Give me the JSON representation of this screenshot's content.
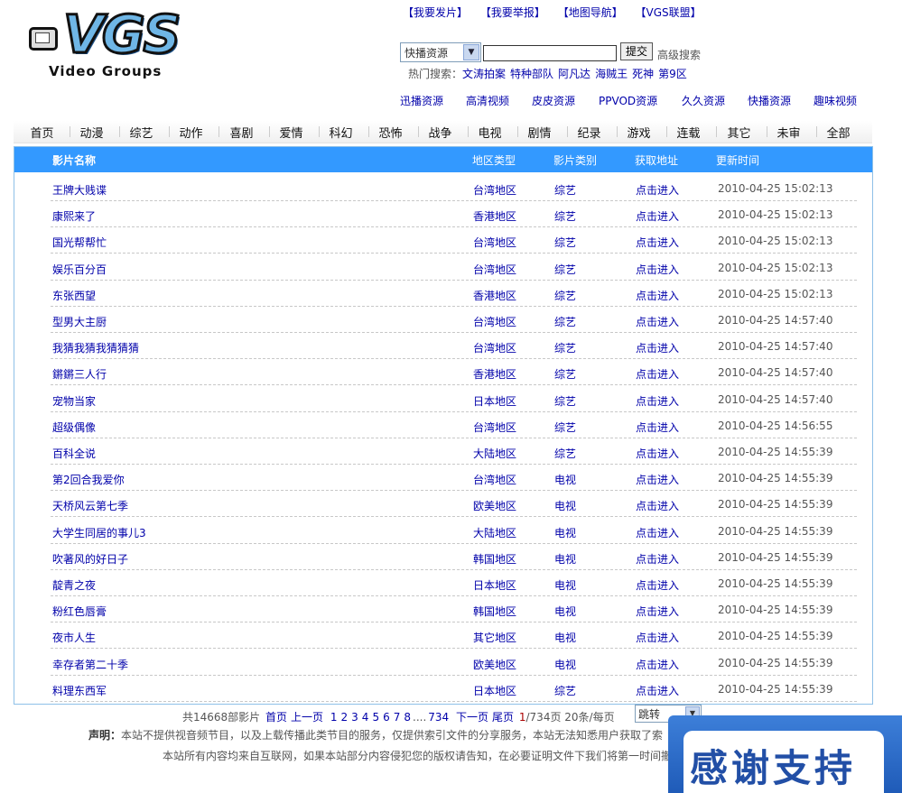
{
  "site": {
    "logo_text": "VGS",
    "logo_sub": "Video Groups"
  },
  "top_links": [
    "【我要发片】",
    "【我要举报】",
    "【地图导航】",
    "【VGS联盟】"
  ],
  "search": {
    "select_value": "快播资源",
    "input_value": "",
    "submit_label": "提交",
    "advanced_label": "高级搜索",
    "hot_label": "热门搜索：",
    "hot_terms": [
      "文涛拍案",
      "特种部队",
      "阿凡达",
      "海贼王",
      "死神",
      "第9区"
    ]
  },
  "resources": [
    "迅播资源",
    "高清视频",
    "皮皮资源",
    "PPVOD资源",
    "久久资源",
    "快播资源",
    "趣味视频"
  ],
  "nav": [
    "首页",
    "动漫",
    "综艺",
    "动作",
    "喜剧",
    "爱情",
    "科幻",
    "恐怖",
    "战争",
    "电视",
    "剧情",
    "纪录",
    "游戏",
    "连载",
    "其它",
    "未审",
    "全部"
  ],
  "list": {
    "headers": {
      "name": "影片名称",
      "region": "地区类型",
      "category": "影片类别",
      "link": "获取地址",
      "updated": "更新时间"
    },
    "rows": [
      {
        "name": "王牌大贱谍",
        "region": "台湾地区",
        "category": "综艺",
        "link": "点击进入",
        "updated": "2010-04-25 15:02:13"
      },
      {
        "name": "康熙来了",
        "region": "香港地区",
        "category": "综艺",
        "link": "点击进入",
        "updated": "2010-04-25 15:02:13"
      },
      {
        "name": "国光帮帮忙",
        "region": "台湾地区",
        "category": "综艺",
        "link": "点击进入",
        "updated": "2010-04-25 15:02:13"
      },
      {
        "name": "娱乐百分百",
        "region": "台湾地区",
        "category": "综艺",
        "link": "点击进入",
        "updated": "2010-04-25 15:02:13"
      },
      {
        "name": "东张西望",
        "region": "香港地区",
        "category": "综艺",
        "link": "点击进入",
        "updated": "2010-04-25 15:02:13"
      },
      {
        "name": "型男大主厨",
        "region": "台湾地区",
        "category": "综艺",
        "link": "点击进入",
        "updated": "2010-04-25 14:57:40"
      },
      {
        "name": "我猜我猜我猜猜猜",
        "region": "台湾地区",
        "category": "综艺",
        "link": "点击进入",
        "updated": "2010-04-25 14:57:40"
      },
      {
        "name": "鏘鏘三人行",
        "region": "香港地区",
        "category": "综艺",
        "link": "点击进入",
        "updated": "2010-04-25 14:57:40"
      },
      {
        "name": "宠物当家",
        "region": "日本地区",
        "category": "综艺",
        "link": "点击进入",
        "updated": "2010-04-25 14:57:40"
      },
      {
        "name": "超级偶像",
        "region": "台湾地区",
        "category": "综艺",
        "link": "点击进入",
        "updated": "2010-04-25 14:56:55"
      },
      {
        "name": "百科全说",
        "region": "大陆地区",
        "category": "综艺",
        "link": "点击进入",
        "updated": "2010-04-25 14:55:39"
      },
      {
        "name": "第2回合我爱你",
        "region": "台湾地区",
        "category": "电视",
        "link": "点击进入",
        "updated": "2010-04-25 14:55:39"
      },
      {
        "name": "天桥风云第七季",
        "region": "欧美地区",
        "category": "电视",
        "link": "点击进入",
        "updated": "2010-04-25 14:55:39"
      },
      {
        "name": "大学生同居的事儿3",
        "region": "大陆地区",
        "category": "电视",
        "link": "点击进入",
        "updated": "2010-04-25 14:55:39"
      },
      {
        "name": "吹著风的好日子",
        "region": "韩国地区",
        "category": "电视",
        "link": "点击进入",
        "updated": "2010-04-25 14:55:39"
      },
      {
        "name": "靛青之夜",
        "region": "日本地区",
        "category": "电视",
        "link": "点击进入",
        "updated": "2010-04-25 14:55:39"
      },
      {
        "name": "粉红色唇膏",
        "region": "韩国地区",
        "category": "电视",
        "link": "点击进入",
        "updated": "2010-04-25 14:55:39"
      },
      {
        "name": "夜市人生",
        "region": "其它地区",
        "category": "电视",
        "link": "点击进入",
        "updated": "2010-04-25 14:55:39"
      },
      {
        "name": "幸存者第二十季",
        "region": "欧美地区",
        "category": "电视",
        "link": "点击进入",
        "updated": "2010-04-25 14:55:39"
      },
      {
        "name": "料理东西军",
        "region": "日本地区",
        "category": "综艺",
        "link": "点击进入",
        "updated": "2010-04-25 14:55:39"
      }
    ]
  },
  "pager": {
    "total": "共14668部影片",
    "first": "首页",
    "prev": "上一页",
    "pages": [
      "1",
      "2",
      "3",
      "4",
      "5",
      "6",
      "7",
      "8"
    ],
    "ellipsis": "....",
    "last_page": "734",
    "next": "下一页",
    "last": "尾页",
    "current": "1",
    "of_pages": "/734页",
    "per_page": "20条/每页",
    "jump_label": "跳转"
  },
  "declaration": {
    "label": "声明：",
    "text": "本站不提供视音频节目，以及上载传播此类节目的服务，仅提供索引文件的分享服务，本站无法知悉用户获取了索"
  },
  "footer_text": "本站所有内容均来自互联网，如果本站部分内容侵犯您的版权请告知，在必要证明文件下我们将第一时间撤",
  "float_ad": {
    "text": "感谢支持"
  },
  "colors": {
    "header_bar": "#3399ff",
    "link": "#0000aa",
    "ad_blue": "#224fa6"
  }
}
